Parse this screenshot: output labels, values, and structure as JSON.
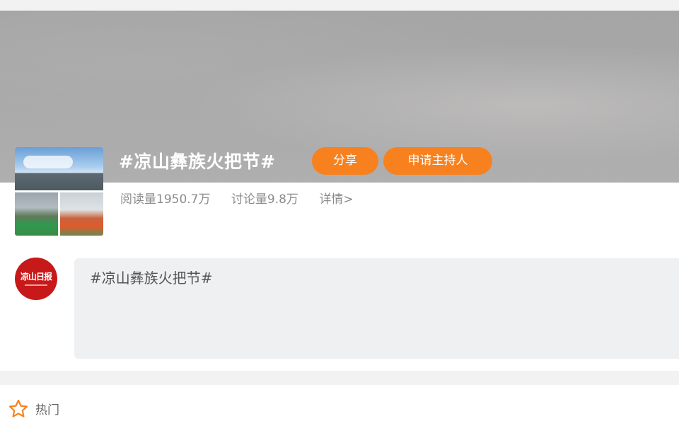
{
  "topic": {
    "title": "#凉山彝族火把节#",
    "share_label": "分享",
    "host_label": "申请主持人",
    "reads": "阅读量1950.7万",
    "discussions": "讨论量9.8万",
    "details_link": "详情>"
  },
  "post": {
    "avatar_text": "凉山日报",
    "composer_text": "#凉山彝族火把节#"
  },
  "section": {
    "hot_label": "热门"
  },
  "colors": {
    "accent": "#f7811e",
    "avatar_red": "#c71919",
    "composer_bg": "#eef0f2",
    "stats_text": "#8c8c8c"
  },
  "icons": {
    "hot": "star-outline-icon"
  }
}
